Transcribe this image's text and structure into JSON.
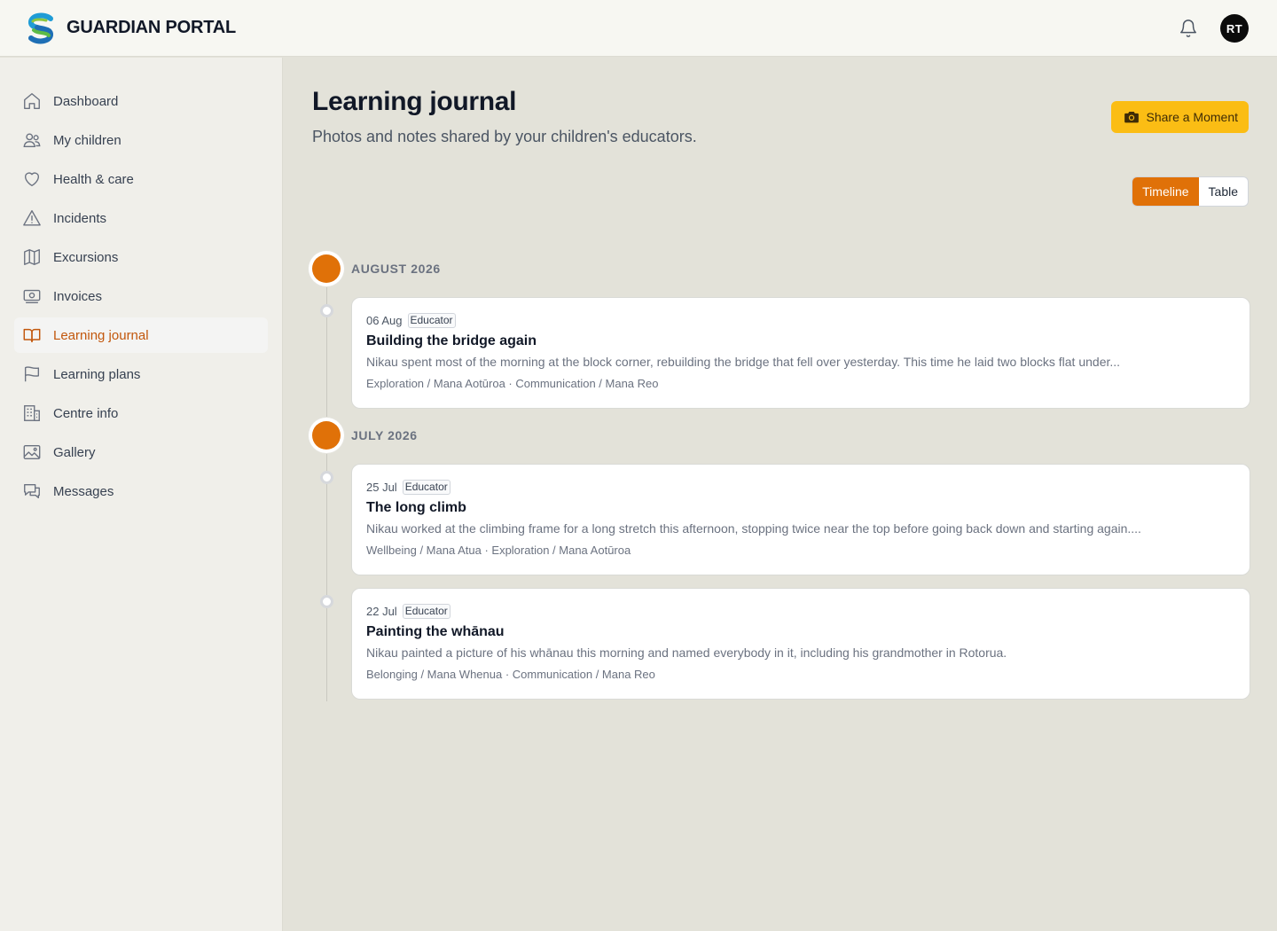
{
  "brand": {
    "name": "GUARDIAN PORTAL"
  },
  "user": {
    "initials": "RT"
  },
  "sidebar": {
    "items": [
      {
        "label": "Dashboard",
        "icon": "home-icon"
      },
      {
        "label": "My children",
        "icon": "users-icon"
      },
      {
        "label": "Health & care",
        "icon": "heart-icon"
      },
      {
        "label": "Incidents",
        "icon": "warning-icon"
      },
      {
        "label": "Excursions",
        "icon": "map-icon"
      },
      {
        "label": "Invoices",
        "icon": "banknote-icon"
      },
      {
        "label": "Learning journal",
        "icon": "book-open-icon",
        "active": true
      },
      {
        "label": "Learning plans",
        "icon": "flag-icon"
      },
      {
        "label": "Centre info",
        "icon": "building-icon"
      },
      {
        "label": "Gallery",
        "icon": "image-icon"
      },
      {
        "label": "Messages",
        "icon": "chat-icon"
      }
    ]
  },
  "header": {
    "title": "Learning journal",
    "subtitle": "Photos and notes shared by your children's educators.",
    "share_label": "Share a Moment"
  },
  "view_toggle": {
    "timeline": "Timeline",
    "table": "Table",
    "selected": "Timeline"
  },
  "colors": {
    "accent": "#e07108",
    "share": "#fbbd14",
    "active_text": "#c2570c"
  },
  "months": [
    {
      "label": "AUGUST 2026",
      "entries": [
        {
          "date": "06 Aug",
          "role": "Educator",
          "title": "Building the bridge again",
          "excerpt": "Nikau spent most of the morning at the block corner, rebuilding the bridge that fell over yesterday. This time he laid two blocks flat under...",
          "tags": "Exploration / Mana Aotūroa · Communication / Mana Reo"
        }
      ]
    },
    {
      "label": "JULY 2026",
      "entries": [
        {
          "date": "25 Jul",
          "role": "Educator",
          "title": "The long climb",
          "excerpt": "Nikau worked at the climbing frame for a long stretch this afternoon, stopping twice near the top before going back down and starting again....",
          "tags": "Wellbeing / Mana Atua · Exploration / Mana Aotūroa"
        },
        {
          "date": "22 Jul",
          "role": "Educator",
          "title": "Painting the whānau",
          "excerpt": "Nikau painted a picture of his whānau this morning and named everybody in it, including his grandmother in Rotorua.",
          "tags": "Belonging / Mana Whenua · Communication / Mana Reo"
        }
      ]
    }
  ]
}
